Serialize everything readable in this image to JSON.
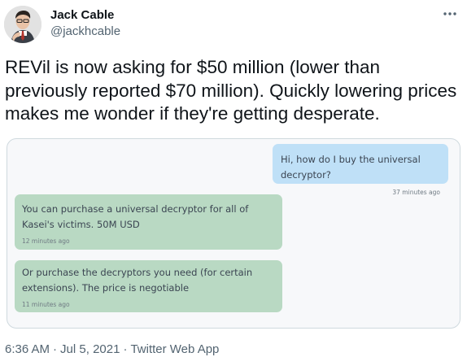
{
  "author": {
    "name": "Jack Cable",
    "handle": "@jackhcable"
  },
  "tweet": {
    "text": "REVil is now asking for $50 million (lower than previously reported $70 million). Quickly lowering prices makes me wonder if they're getting desperate."
  },
  "chat": {
    "messages": [
      {
        "direction": "outgoing",
        "text": "Hi, how do I buy the universal decryptor?",
        "time": "37 minutes ago"
      },
      {
        "direction": "incoming",
        "text": "You can purchase a universal decryptor for all of Kasei's victims. 50M USD",
        "time": "12 minutes ago"
      },
      {
        "direction": "incoming",
        "text": "Or purchase the decryptors you need (for certain extensions). The price is negotiable",
        "time": "11 minutes ago"
      }
    ]
  },
  "meta": {
    "time": "6:36 AM",
    "separator": "·",
    "date": "Jul 5, 2021",
    "app": "Twitter Web App"
  },
  "icons": {
    "avatar": "avatar-photo",
    "more": "more-dots-icon"
  },
  "colors": {
    "outgoing_bubble": "#bfe0f7",
    "incoming_bubble": "#b9d9c3",
    "secondary_text": "#536471"
  }
}
